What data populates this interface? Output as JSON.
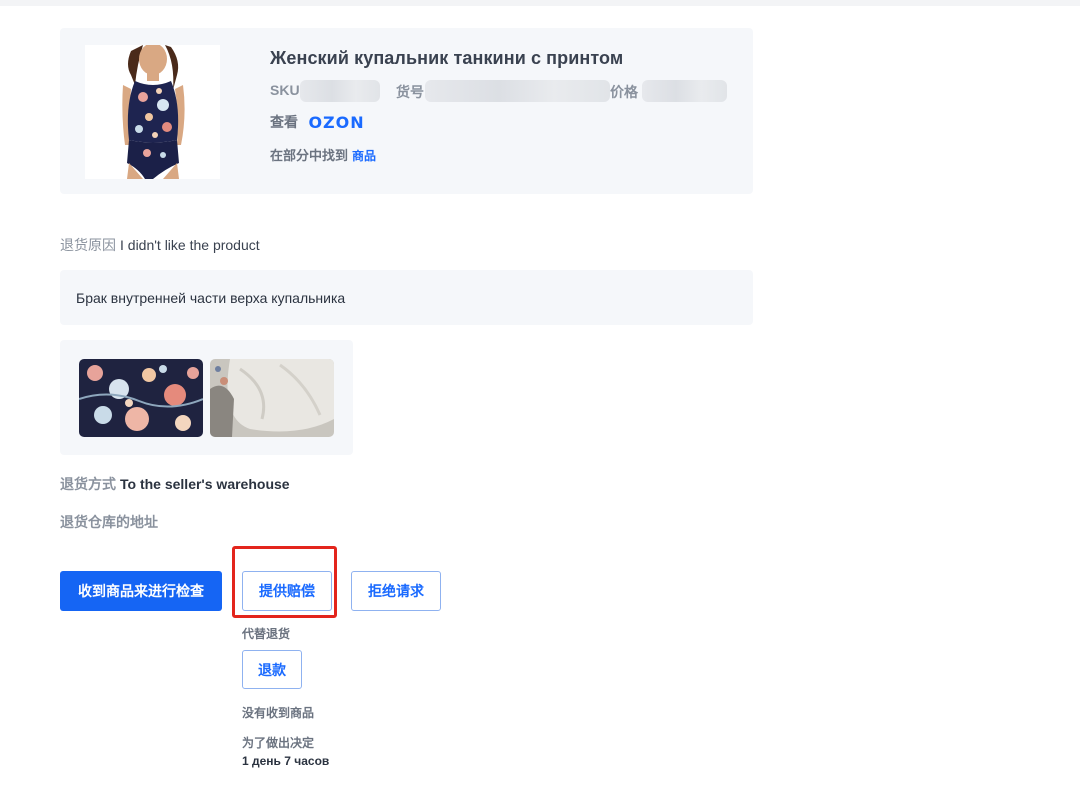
{
  "product": {
    "title": "Женский купальник танкини с принтом",
    "sku_label": "SKU",
    "article_label": "货号",
    "price_label": "价格",
    "view_label": "查看",
    "ozon_link": "OZON",
    "found_label": "在部分中找到",
    "found_link": "商品",
    "image_icon": "swimsuit-photo"
  },
  "return_reason": {
    "label": "退货原因",
    "value": "I didn't like the product"
  },
  "comment": "Брак внутренней части верха купальника",
  "photos": [
    {
      "name": "floral-fabric-photo"
    },
    {
      "name": "white-lining-photo"
    }
  ],
  "return_method": {
    "label": "退货方式",
    "value": "To the seller's warehouse"
  },
  "warehouse_address_label": "退货仓库的地址",
  "actions": {
    "receive_inspect": "收到商品来进行检查",
    "offer_compensation": "提供赔偿",
    "reject_request": "拒绝请求",
    "instead_of_return": "代替退货",
    "refund": "退款",
    "not_received": "没有收到商品",
    "decision_label": "为了做出决定",
    "decision_time": "1 день 7 часов"
  },
  "colors": {
    "accent": "#1565f4",
    "link": "#1a6aff",
    "highlight": "#e3251c",
    "panel": "#f5f7fa"
  }
}
